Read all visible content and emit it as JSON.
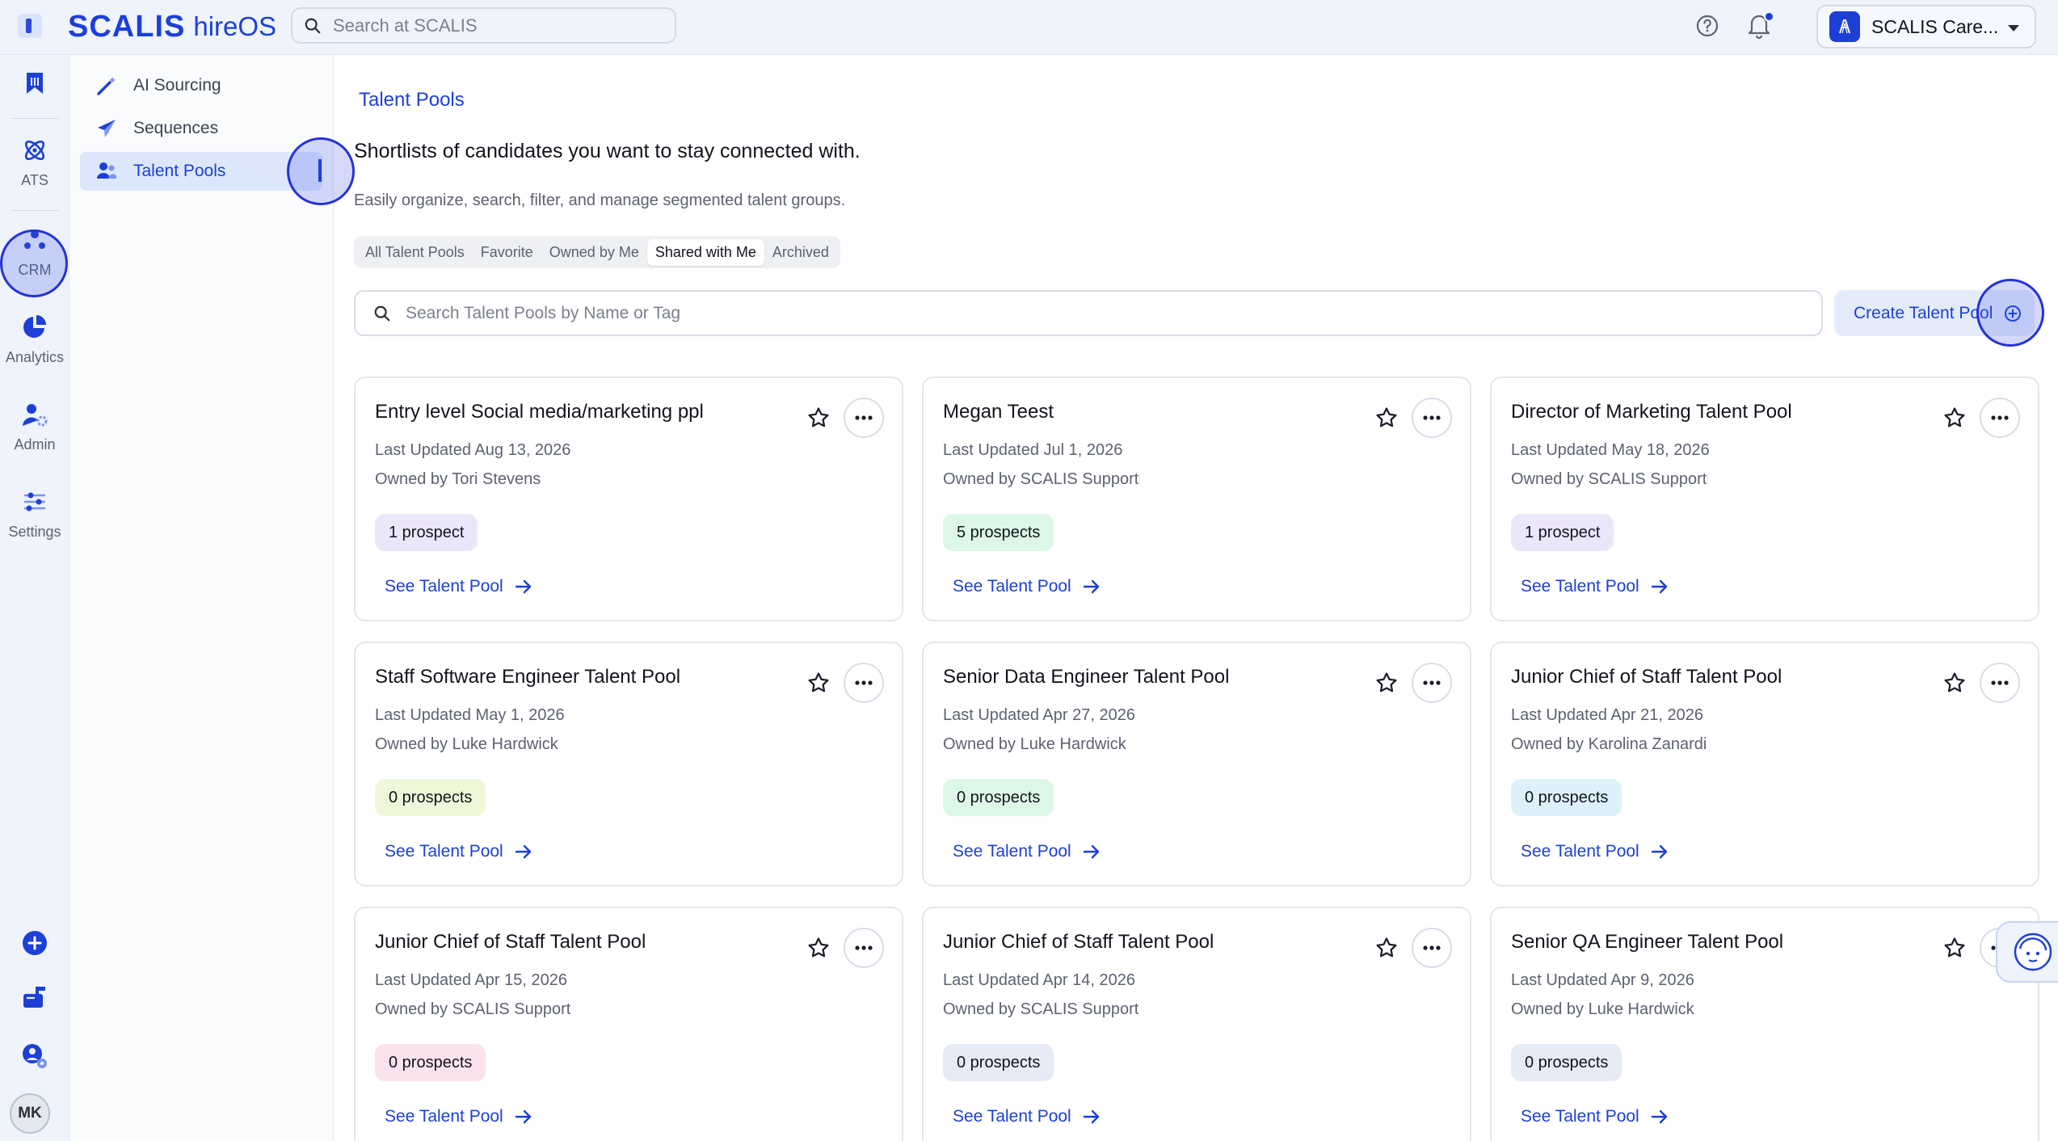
{
  "app": {
    "brand": "SCALIS",
    "product": "hireOS",
    "search_placeholder": "Search at SCALIS",
    "account_name": "SCALIS Care...",
    "user_initials": "MK"
  },
  "rail": {
    "items": [
      {
        "name": "saved",
        "label": ""
      },
      {
        "name": "ats",
        "label": "ATS"
      },
      {
        "name": "crm",
        "label": "CRM"
      },
      {
        "name": "analytics",
        "label": "Analytics"
      },
      {
        "name": "admin",
        "label": "Admin"
      },
      {
        "name": "settings",
        "label": "Settings"
      }
    ]
  },
  "subnav": {
    "items": [
      {
        "label": "AI Sourcing",
        "icon": "wand-icon"
      },
      {
        "label": "Sequences",
        "icon": "paper-plane-icon"
      },
      {
        "label": "Talent Pools",
        "icon": "users-icon",
        "active": true
      }
    ]
  },
  "main": {
    "breadcrumb": "Talent Pools",
    "headline": "Shortlists of candidates you want to stay connected with.",
    "subline": "Easily organize, search, filter, and manage segmented talent groups.",
    "tabs": [
      {
        "label": "All Talent Pools"
      },
      {
        "label": "Favorite"
      },
      {
        "label": "Owned by Me"
      },
      {
        "label": "Shared with Me",
        "selected": true
      },
      {
        "label": "Archived"
      }
    ],
    "search_placeholder": "Search Talent Pools by Name or Tag",
    "create_label": "Create Talent Pool",
    "link_label": "See Talent Pool"
  },
  "cards": [
    {
      "title": "Entry level Social media/marketing ppl",
      "updated": "Last Updated Aug 13, 2026",
      "owner": "Owned by Tori Stevens",
      "badge": "1 prospect",
      "badge_color": "#ece6fb"
    },
    {
      "title": "Megan Teest",
      "updated": "Last Updated Jul 1, 2026",
      "owner": "Owned by SCALIS Support",
      "badge": "5 prospects",
      "badge_color": "#ddf7e6"
    },
    {
      "title": "Director of Marketing Talent Pool",
      "updated": "Last Updated May 18, 2026",
      "owner": "Owned by SCALIS Support",
      "badge": "1 prospect",
      "badge_color": "#ece6fb"
    },
    {
      "title": "Staff Software Engineer Talent Pool",
      "updated": "Last Updated May 1, 2026",
      "owner": "Owned by Luke Hardwick",
      "badge": "0 prospects",
      "badge_color": "#eef8d9"
    },
    {
      "title": "Senior Data Engineer Talent Pool",
      "updated": "Last Updated Apr 27, 2026",
      "owner": "Owned by Luke Hardwick",
      "badge": "0 prospects",
      "badge_color": "#ddf7e6"
    },
    {
      "title": "Junior Chief of Staff Talent Pool",
      "updated": "Last Updated Apr 21, 2026",
      "owner": "Owned by Karolina Zanardi",
      "badge": "0 prospects",
      "badge_color": "#ddf1fb"
    },
    {
      "title": "Junior Chief of Staff Talent Pool",
      "updated": "Last Updated Apr 15, 2026",
      "owner": "Owned by SCALIS Support",
      "badge": "0 prospects",
      "badge_color": "#fbe3ee"
    },
    {
      "title": "Junior Chief of Staff Talent Pool",
      "updated": "Last Updated Apr 14, 2026",
      "owner": "Owned by SCALIS Support",
      "badge": "0 prospects",
      "badge_color": "#e7eaf7"
    },
    {
      "title": "Senior QA Engineer Talent Pool",
      "updated": "Last Updated Apr 9, 2026",
      "owner": "Owned by Luke Hardwick",
      "badge": "0 prospects",
      "badge_color": "#e7eaf7"
    }
  ],
  "colors": {
    "accent": "#1d3fd6",
    "rail_bg": "#eef3fc",
    "click_ring": "#2433d6"
  }
}
